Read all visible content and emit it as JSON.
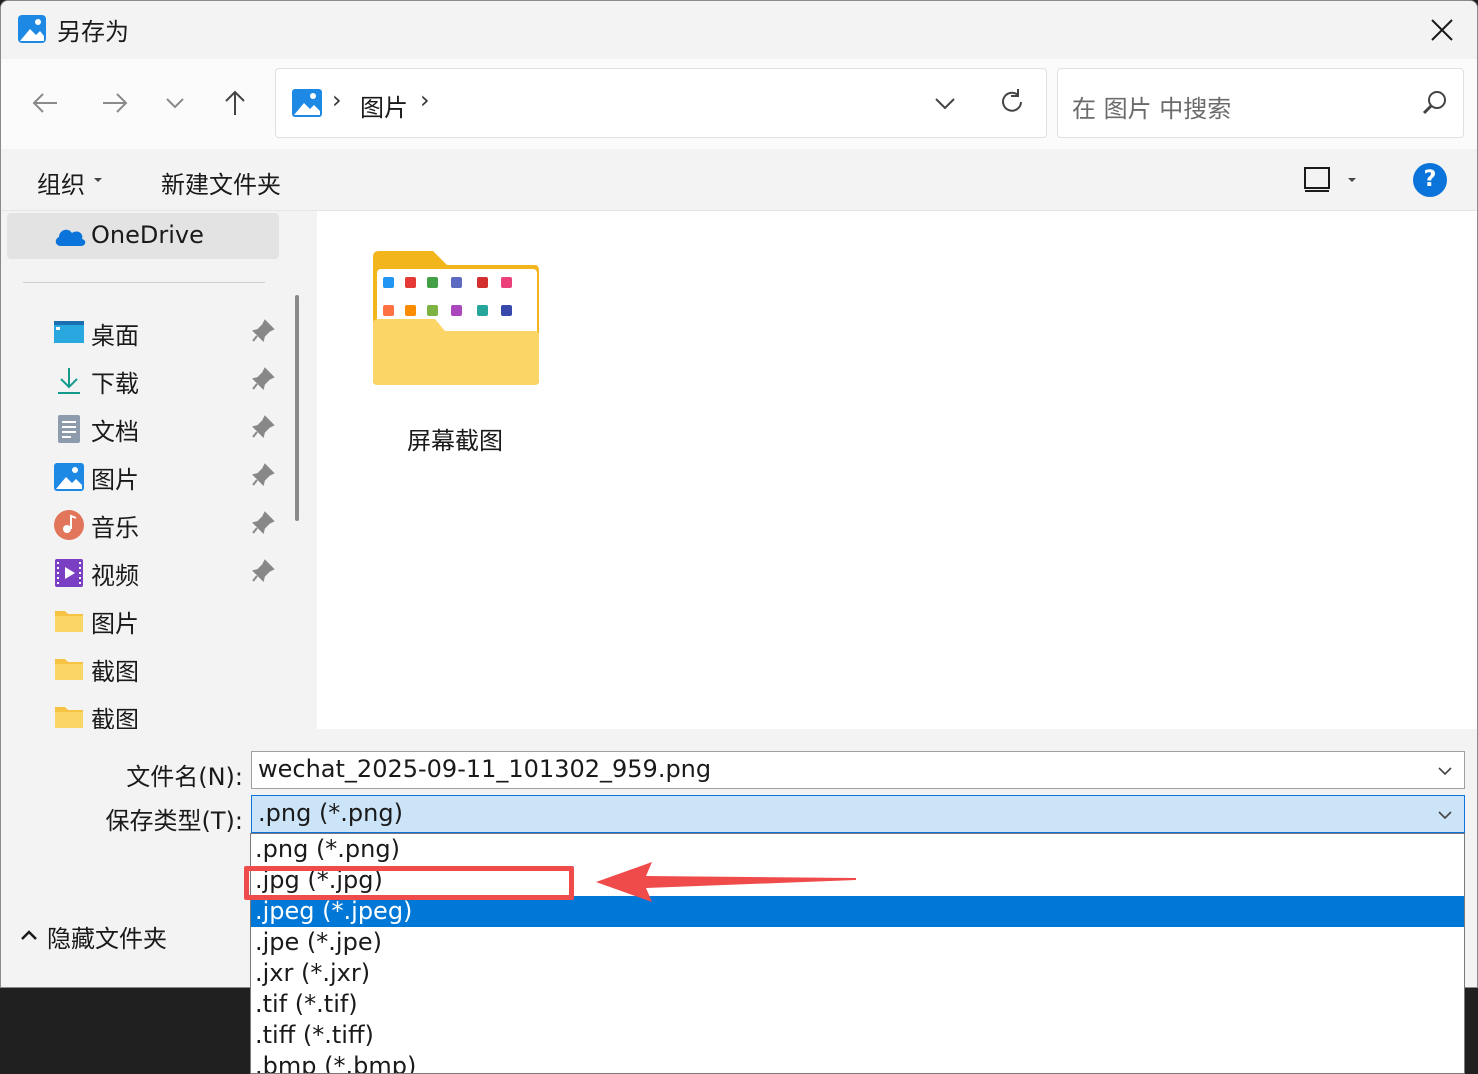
{
  "window": {
    "title": "另存为"
  },
  "nav": {
    "address_location": "图片",
    "search_placeholder": "在 图片 中搜索"
  },
  "toolbar": {
    "organize_label": "组织",
    "new_folder_label": "新建文件夹",
    "help_label": "?"
  },
  "sidebar": {
    "top_item": "OneDrive",
    "items": [
      {
        "label": "桌面",
        "icon": "desktop-icon",
        "pinned": true
      },
      {
        "label": "下载",
        "icon": "download-icon",
        "pinned": true
      },
      {
        "label": "文档",
        "icon": "documents-icon",
        "pinned": true
      },
      {
        "label": "图片",
        "icon": "pictures-icon",
        "pinned": true
      },
      {
        "label": "音乐",
        "icon": "music-icon",
        "pinned": true
      },
      {
        "label": "视频",
        "icon": "videos-icon",
        "pinned": true
      },
      {
        "label": "图片",
        "icon": "folder-icon",
        "pinned": false
      },
      {
        "label": "截图",
        "icon": "folder-icon",
        "pinned": false
      },
      {
        "label": "截图",
        "icon": "folder-icon",
        "pinned": false
      }
    ]
  },
  "content": {
    "folders": [
      {
        "name": "屏幕截图"
      }
    ]
  },
  "form": {
    "filename_label": "文件名(N):",
    "filename_value": "wechat_2025-09-11_101302_959.png",
    "type_label": "保存类型(T):",
    "type_value": ".png (*.png)"
  },
  "footer": {
    "hide_folders_label": "隐藏文件夹"
  },
  "type_options": [
    {
      "label": ".png (*.png)",
      "selected": false
    },
    {
      "label": ".jpg (*.jpg)",
      "selected": false
    },
    {
      "label": ".jpeg (*.jpeg)",
      "selected": true
    },
    {
      "label": ".jpe (*.jpe)",
      "selected": false
    },
    {
      "label": ".jxr (*.jxr)",
      "selected": false
    },
    {
      "label": ".tif (*.tif)",
      "selected": false
    },
    {
      "label": ".tiff (*.tiff)",
      "selected": false
    },
    {
      "label": ".bmp (*.bmp)",
      "selected": false
    }
  ],
  "colors": {
    "accent": "#0078d7",
    "annotation": "#ef4b4b",
    "type_field_bg": "#cce4f7"
  }
}
